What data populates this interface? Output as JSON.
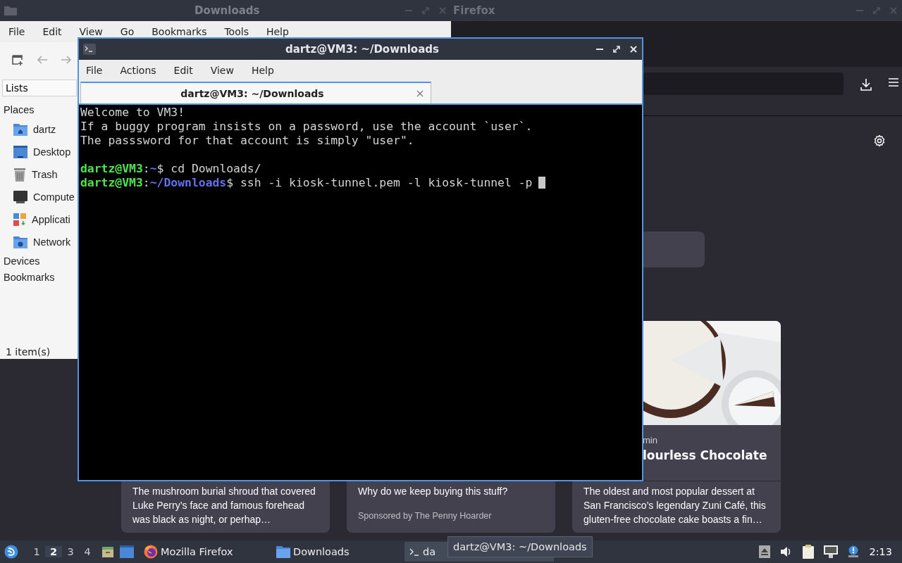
{
  "firefox": {
    "title": "Firefox",
    "cards": [
      {
        "lines": [
          "The mushroom burial shroud that covered Luke Perry’s face and famous forehead was black as night, or perhap…"
        ]
      },
      {
        "lines": [
          "Why do we keep buying this stuff?"
        ],
        "sponsor": "Sponsored by The Penny Hoarder"
      },
      {
        "kind": "picture",
        "meta": "min",
        "headline": "lourless Chocolate",
        "lines": [
          "The oldest and most popular dessert at San Francisco’s legendary Zuni Café, this gluten-free chocolate cake boasts a fin…"
        ]
      }
    ]
  },
  "file_manager": {
    "title": "Downloads",
    "menu": [
      "File",
      "Edit",
      "View",
      "Go",
      "Bookmarks",
      "Tools",
      "Help"
    ],
    "side_pane": "Lists",
    "sections": [
      {
        "label": "Places",
        "items": [
          {
            "label": "dartz",
            "kind": "home"
          },
          {
            "label": "Desktop",
            "kind": "desktop"
          },
          {
            "label": "Trash",
            "kind": "trash"
          },
          {
            "label": "Compute",
            "kind": "computer"
          },
          {
            "label": "Applicati",
            "kind": "apps"
          },
          {
            "label": "Network",
            "kind": "network"
          }
        ]
      },
      {
        "label": "Devices"
      },
      {
        "label": "Bookmarks"
      }
    ],
    "status": "1 item(s)"
  },
  "terminal": {
    "title": "dartz@VM3: ~/Downloads",
    "menu": [
      "File",
      "Actions",
      "Edit",
      "View",
      "Help"
    ],
    "tabs": [
      {
        "label": "dartz@VM3: ~/Downloads",
        "selected": true
      }
    ],
    "lines": [
      {
        "kind": "output",
        "text": "Welcome to VM3!"
      },
      {
        "kind": "output",
        "text": "If a buggy program insists on a password, use the account `user`."
      },
      {
        "kind": "output",
        "text": "The passsword for that account is simply \"user\"."
      },
      {
        "kind": "blank"
      },
      {
        "kind": "prompt",
        "user": "dartz@VM3",
        "separator": ":",
        "path": "~",
        "sign": "$",
        "command": "cd Downloads/"
      },
      {
        "kind": "prompt",
        "user": "dartz@VM3",
        "separator": ":",
        "path": "~/Downloads",
        "sign": "$",
        "command": "ssh -i kiosk-tunnel.pem -l kiosk-tunnel -p",
        "cursor": true
      }
    ]
  },
  "taskbar": {
    "workspaces": [
      {
        "label": "1",
        "selected": false
      },
      {
        "label": "2",
        "selected": true
      },
      {
        "label": "3",
        "selected": false
      },
      {
        "label": "4",
        "selected": false
      }
    ],
    "tasks": [
      {
        "kind": "firefox",
        "label": "Mozilla Firefox",
        "selected": false
      },
      {
        "kind": "folder",
        "label": "Downloads",
        "selected": false
      },
      {
        "kind": "terminal",
        "label": "da",
        "selected": true
      }
    ],
    "tooltip": "dartz@VM3: ~/Downloads",
    "clock": "2:13"
  }
}
